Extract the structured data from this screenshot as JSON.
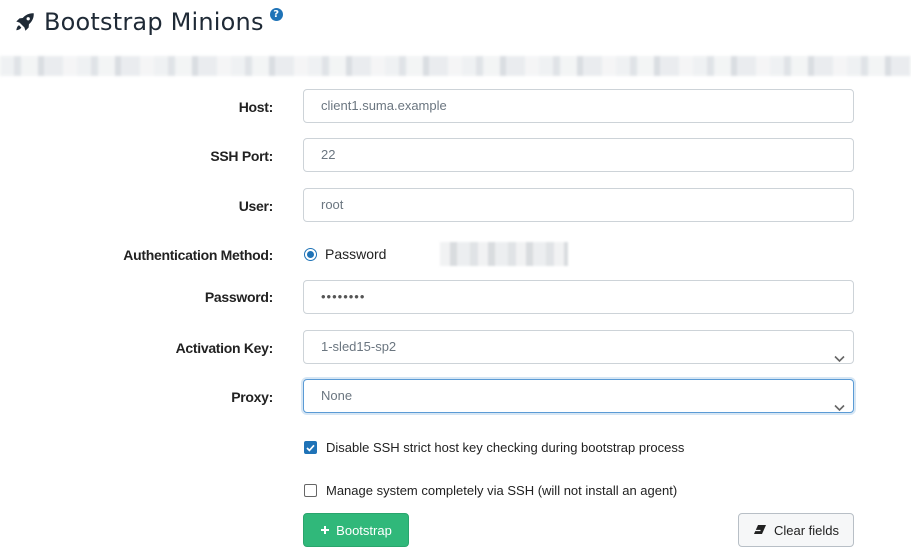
{
  "header": {
    "title": "Bootstrap Minions",
    "title_icon": "rocket-icon",
    "help_icon": "help-icon",
    "help_glyph": "?"
  },
  "form": {
    "host": {
      "label": "Host:",
      "placeholder": "client1.suma.example"
    },
    "ssh_port": {
      "label": "SSH Port:",
      "placeholder": "22"
    },
    "user": {
      "label": "User:",
      "placeholder": "root"
    },
    "auth_method": {
      "label": "Authentication Method:",
      "selected_option": "Password"
    },
    "password": {
      "label": "Password:",
      "value": "••••••••"
    },
    "activation_key": {
      "label": "Activation Key:",
      "value": "1-sled15-sp2"
    },
    "proxy": {
      "label": "Proxy:",
      "value": "None"
    },
    "disable_strict_host_key": {
      "label": "Disable SSH strict host key checking during bootstrap process",
      "checked": true
    },
    "manage_via_ssh": {
      "label": "Manage system completely via SSH (will not install an agent)",
      "checked": false
    }
  },
  "actions": {
    "bootstrap_label": "Bootstrap",
    "clear_label": "Clear fields"
  },
  "colors": {
    "primary": "#1f73b7",
    "success": "#30b87a"
  }
}
